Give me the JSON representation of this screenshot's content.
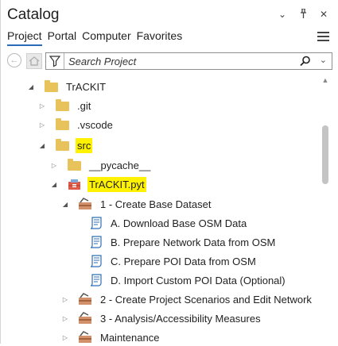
{
  "pane": {
    "title": "Catalog",
    "options_icon": "chevron-down-icon",
    "pin_icon": "pin-icon",
    "close_icon": "close-icon"
  },
  "tabs": [
    {
      "label": "Project",
      "active": true
    },
    {
      "label": "Portal",
      "active": false
    },
    {
      "label": "Computer",
      "active": false
    },
    {
      "label": "Favorites",
      "active": false
    }
  ],
  "search": {
    "placeholder": "Search Project"
  },
  "colors": {
    "highlight": "#fff200",
    "folder": "#e8c25a",
    "tab_underline": "#2a6bb8"
  },
  "tree": {
    "trackit": "TrACKIT",
    "git": ".git",
    "vscode": ".vscode",
    "src": "src",
    "pycache": "__pycache__",
    "toolbox": "TrACKIT.pyt",
    "toolset1": "1 - Create Base Dataset",
    "tool_a": "A. Download Base OSM Data",
    "tool_b": "B. Prepare Network Data from OSM",
    "tool_c": "C. Prepare POI Data from OSM",
    "tool_d": "D. Import Custom POI Data (Optional)",
    "toolset2": "2 - Create Project Scenarios and Edit Network",
    "toolset3": "3 - Analysis/Accessibility Measures",
    "maintenance": "Maintenance"
  }
}
